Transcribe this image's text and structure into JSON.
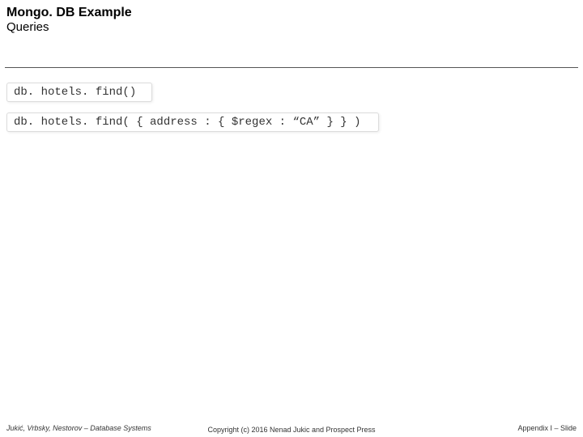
{
  "header": {
    "title_line1": "Mongo. DB Example",
    "title_line2": "Queries"
  },
  "code": {
    "line1": "db. hotels. find()",
    "line2": "db. hotels. find( { address : { $regex : “CA” } } )"
  },
  "footer": {
    "left": "Jukić, Vrbsky, Nestorov – Database Systems",
    "center": "Copyright (c) 2016 Nenad Jukic and Prospect Press",
    "right": "Appendix I – Slide"
  }
}
